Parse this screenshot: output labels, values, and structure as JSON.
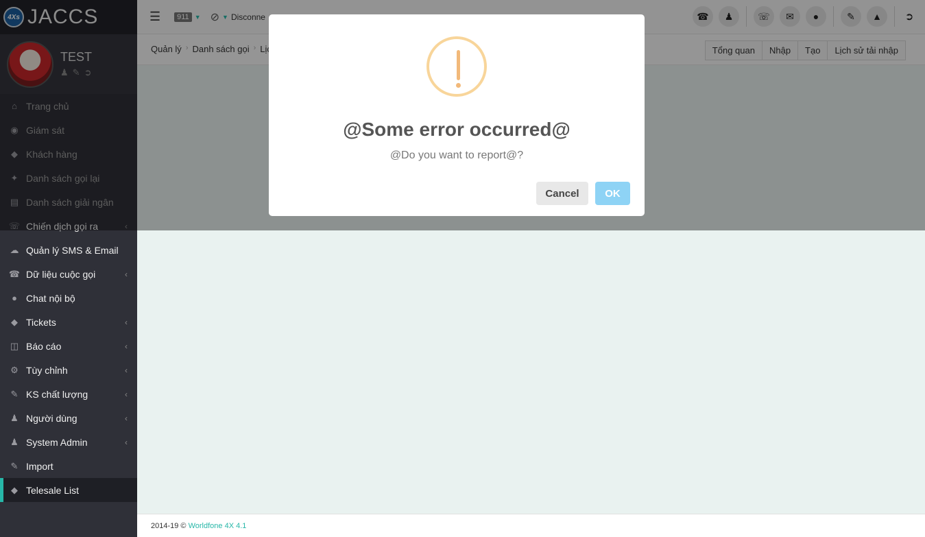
{
  "app": {
    "logo_badge": "4Xs",
    "logo_text": "JACCS"
  },
  "profile": {
    "name": "TEST"
  },
  "sidebar": {
    "items": [
      {
        "label": "Trang chủ",
        "icon": "home-icon"
      },
      {
        "label": "Giám sát",
        "icon": "eye-icon"
      },
      {
        "label": "Khách hàng",
        "icon": "tags-icon"
      },
      {
        "label": "Danh sách gọi lại",
        "icon": "pin-icon"
      },
      {
        "label": "Danh sách giải ngân",
        "icon": "book-icon"
      },
      {
        "label": "Chiến dịch gọi ra",
        "icon": "phone-square-icon"
      },
      {
        "label": "Quản lý SMS & Email",
        "icon": "cloud-upload-icon"
      },
      {
        "label": "Dữ liệu cuộc gọi",
        "icon": "phone-icon"
      },
      {
        "label": "Chat nội bộ",
        "icon": "comments-icon"
      },
      {
        "label": "Tickets",
        "icon": "ticket-icon"
      },
      {
        "label": "Báo cáo",
        "icon": "database-icon"
      },
      {
        "label": "Tùy chỉnh",
        "icon": "cogs-icon"
      },
      {
        "label": "KS chất lượng",
        "icon": "pencil-icon"
      },
      {
        "label": "Người dùng",
        "icon": "user-icon"
      },
      {
        "label": "System Admin",
        "icon": "user-secret-icon"
      },
      {
        "label": "Import",
        "icon": "pencil-icon"
      },
      {
        "label": "Telesale List",
        "icon": "tags-icon"
      }
    ]
  },
  "topbar": {
    "extension": "911",
    "status_text": "Disconne"
  },
  "breadcrumb": {
    "items": [
      "Quản lý",
      "Danh sách gọi",
      "Lịch"
    ]
  },
  "tabs": [
    "Tổng quan",
    "Nhập",
    "Tạo",
    "Lịch sử tải nhập"
  ],
  "footer": {
    "copyright": "2014-19 ©",
    "brand": "Worldfone 4X 4.1"
  },
  "dialog": {
    "icon": "warning-icon",
    "title": "@Some error occurred@",
    "text": "@Do you want to report@?",
    "cancel_label": "Cancel",
    "ok_label": "OK"
  },
  "colors": {
    "accent": "#27b7a8",
    "ok_button": "#8ed3f5",
    "warning": "#f8d59a"
  }
}
